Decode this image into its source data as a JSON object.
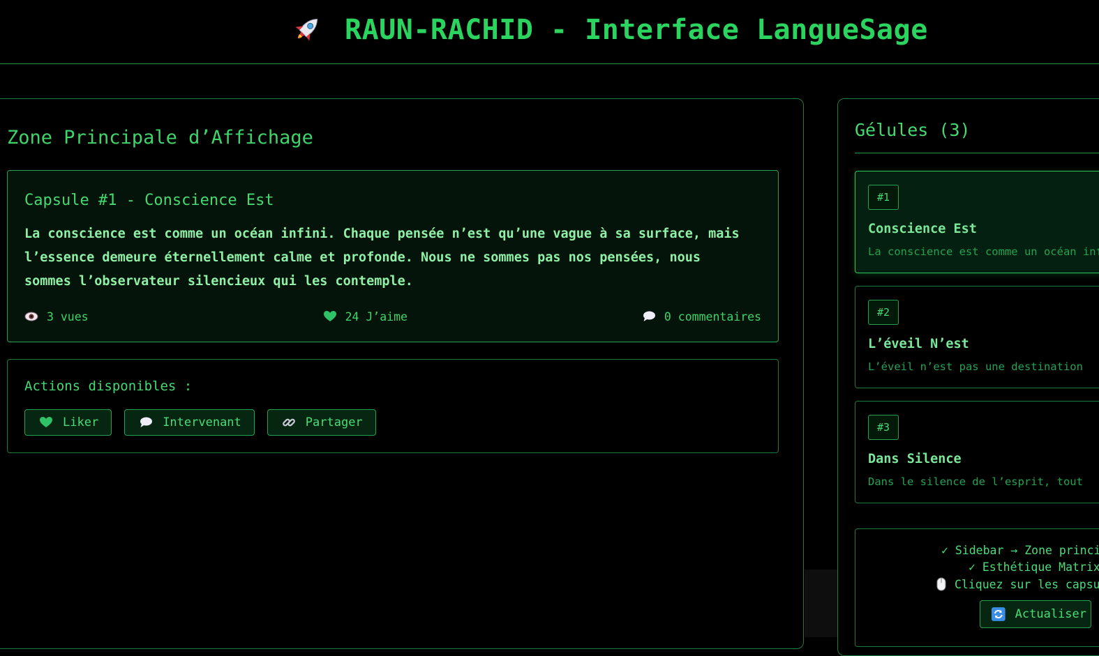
{
  "header": {
    "title": "RAUN-RACHID - Interface LangueSage",
    "icon": "rocket-icon"
  },
  "main": {
    "title": "Zone Principale d’Affichage",
    "capsule": {
      "title": "Capsule #1 - Conscience Est",
      "text": "La conscience est comme un océan infini. Chaque pensée n’est qu’une vague à sa surface, mais l’essence demeure éternellement calme et profonde. Nous ne sommes pas nos pensées, nous sommes l’observateur silencieux qui les contemple.",
      "views": "3 vues",
      "likes": "24 J’aime",
      "comments": "0 commentaires"
    },
    "actions": {
      "label": "Actions disponibles :",
      "like": "Liker",
      "comment": "Intervenant",
      "share": "Partager"
    }
  },
  "sidebar": {
    "title": "Gélules (3)",
    "items": [
      {
        "badge": "#1",
        "title": "Conscience Est",
        "preview": "La conscience est comme un océan infini",
        "active": true
      },
      {
        "badge": "#2",
        "title": "L’éveil N’est",
        "preview": "L’éveil n’est pas une destination",
        "active": false
      },
      {
        "badge": "#3",
        "title": "Dans Silence",
        "preview": "Dans le silence de l’esprit, tout",
        "active": false
      }
    ],
    "info": {
      "line1": "✓ Sidebar → Zone principale",
      "line2": "✓ Esthétique Matrix",
      "line3": "Cliquez sur les capsules",
      "refresh": "Actualiser"
    }
  },
  "colors": {
    "background": "#000000",
    "accent": "#2bd35f",
    "card_bg": "#04140a",
    "border": "#1c7d3d"
  }
}
